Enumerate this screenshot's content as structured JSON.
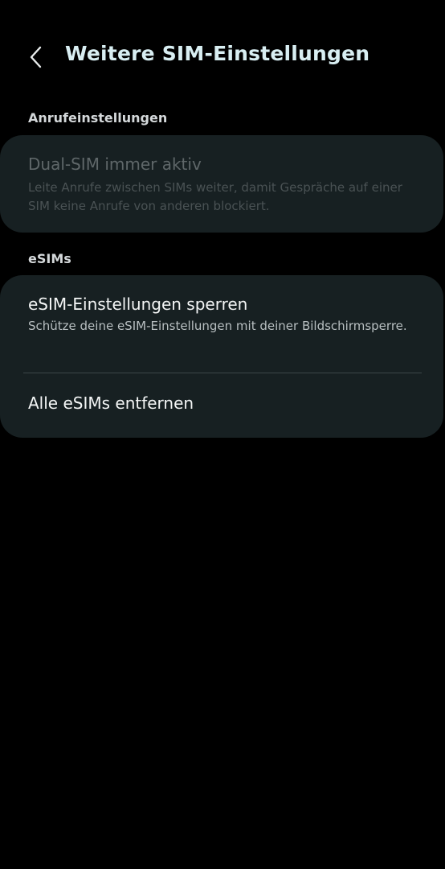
{
  "header": {
    "back_icon": "chevron-left-icon",
    "title": "Weitere SIM-Einstellungen"
  },
  "sections": {
    "calls": {
      "label": "Anrufeinstellungen",
      "dual_sim": {
        "title": "Dual-SIM immer aktiv",
        "subtitle": "Leite Anrufe zwischen SIMs weiter, damit Gespräche auf einer SIM keine Anrufe von anderen blockiert.",
        "enabled": false
      }
    },
    "esims": {
      "label": "eSIMs",
      "lock_settings": {
        "title": "eSIM-Einstellungen sperren",
        "subtitle": "Schütze deine eSIM-Einstellungen mit deiner Bildschirmsperre."
      },
      "remove_all": {
        "title": "Alle eSIMs entfernen"
      }
    }
  },
  "colors": {
    "background": "#000000",
    "card": "#172022",
    "title": "#d8eef2"
  }
}
